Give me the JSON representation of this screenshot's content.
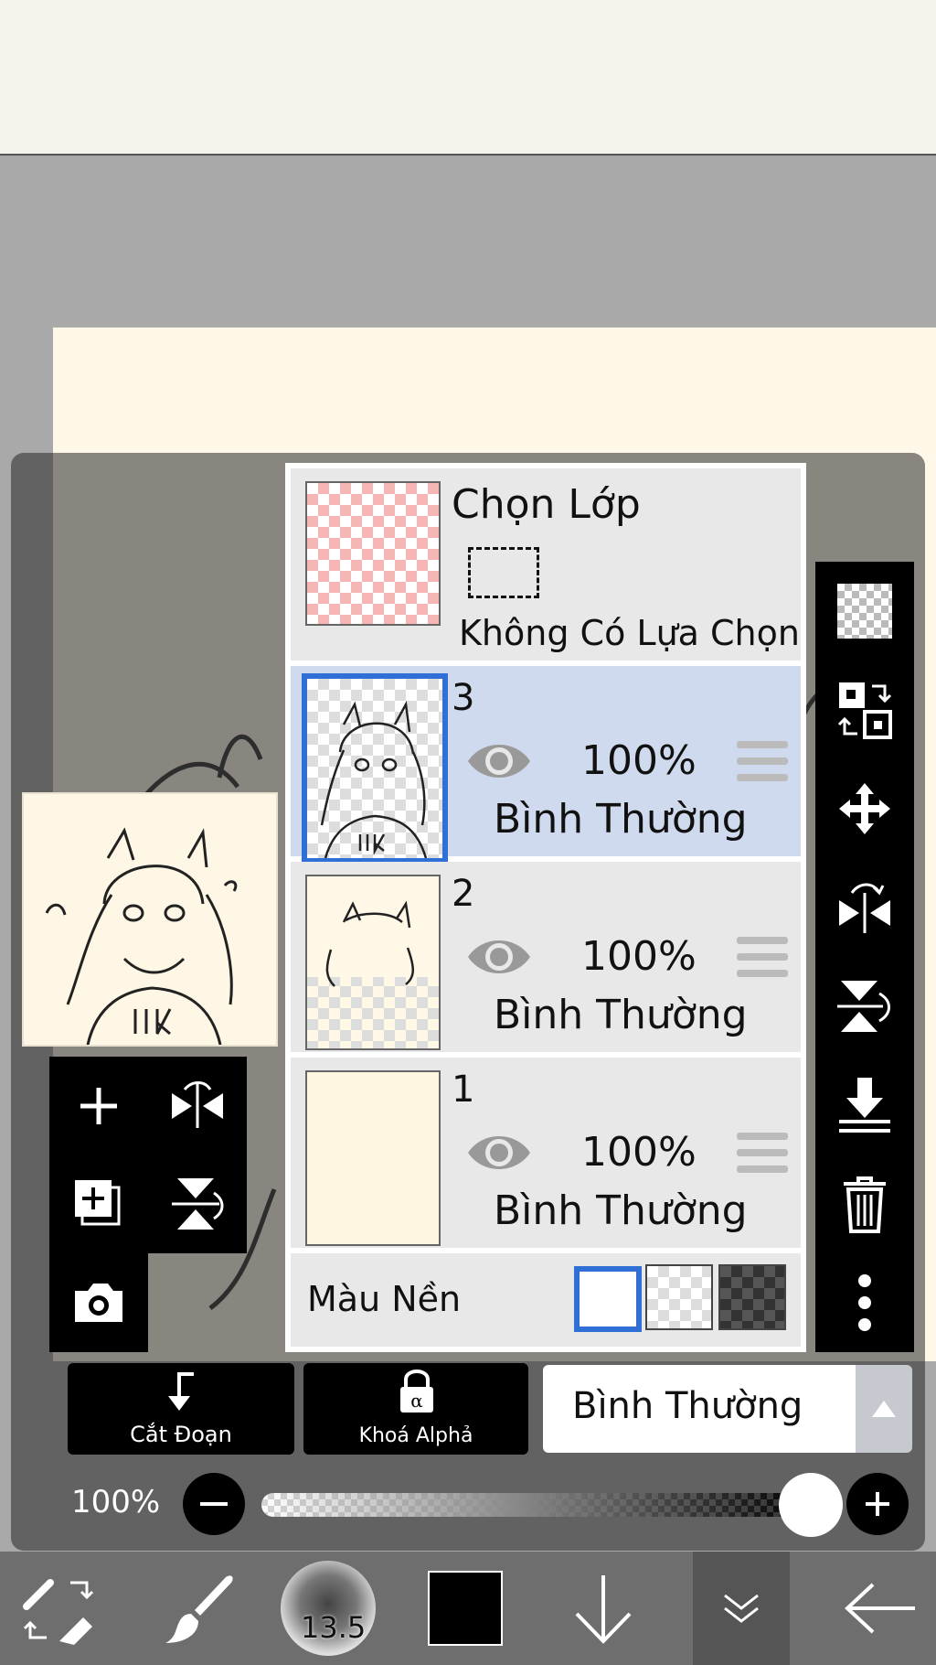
{
  "layers_panel": {
    "selection_layer": {
      "title": "Chọn Lớp",
      "status": "Không Có Lựa Chọn"
    },
    "layers": [
      {
        "name": "3",
        "opacity": "100%",
        "blend": "Bình Thường",
        "selected": true
      },
      {
        "name": "2",
        "opacity": "100%",
        "blend": "Bình Thường",
        "selected": false
      },
      {
        "name": "1",
        "opacity": "100%",
        "blend": "Bình Thường",
        "selected": false
      }
    ],
    "background_label": "Màu Nền"
  },
  "bottom_controls": {
    "clip_label": "Cắt Đoạn",
    "alpha_lock_label": "Khoá Alphả",
    "blend_mode": "Bình Thường",
    "opacity_label": "100%",
    "opacity_value": 1.0
  },
  "toolbar": {
    "brush_size": "13.5"
  },
  "colors": {
    "selected_layer": "#cfdaee",
    "selection_accent": "#2f6fd6",
    "current_color": "#000000"
  }
}
